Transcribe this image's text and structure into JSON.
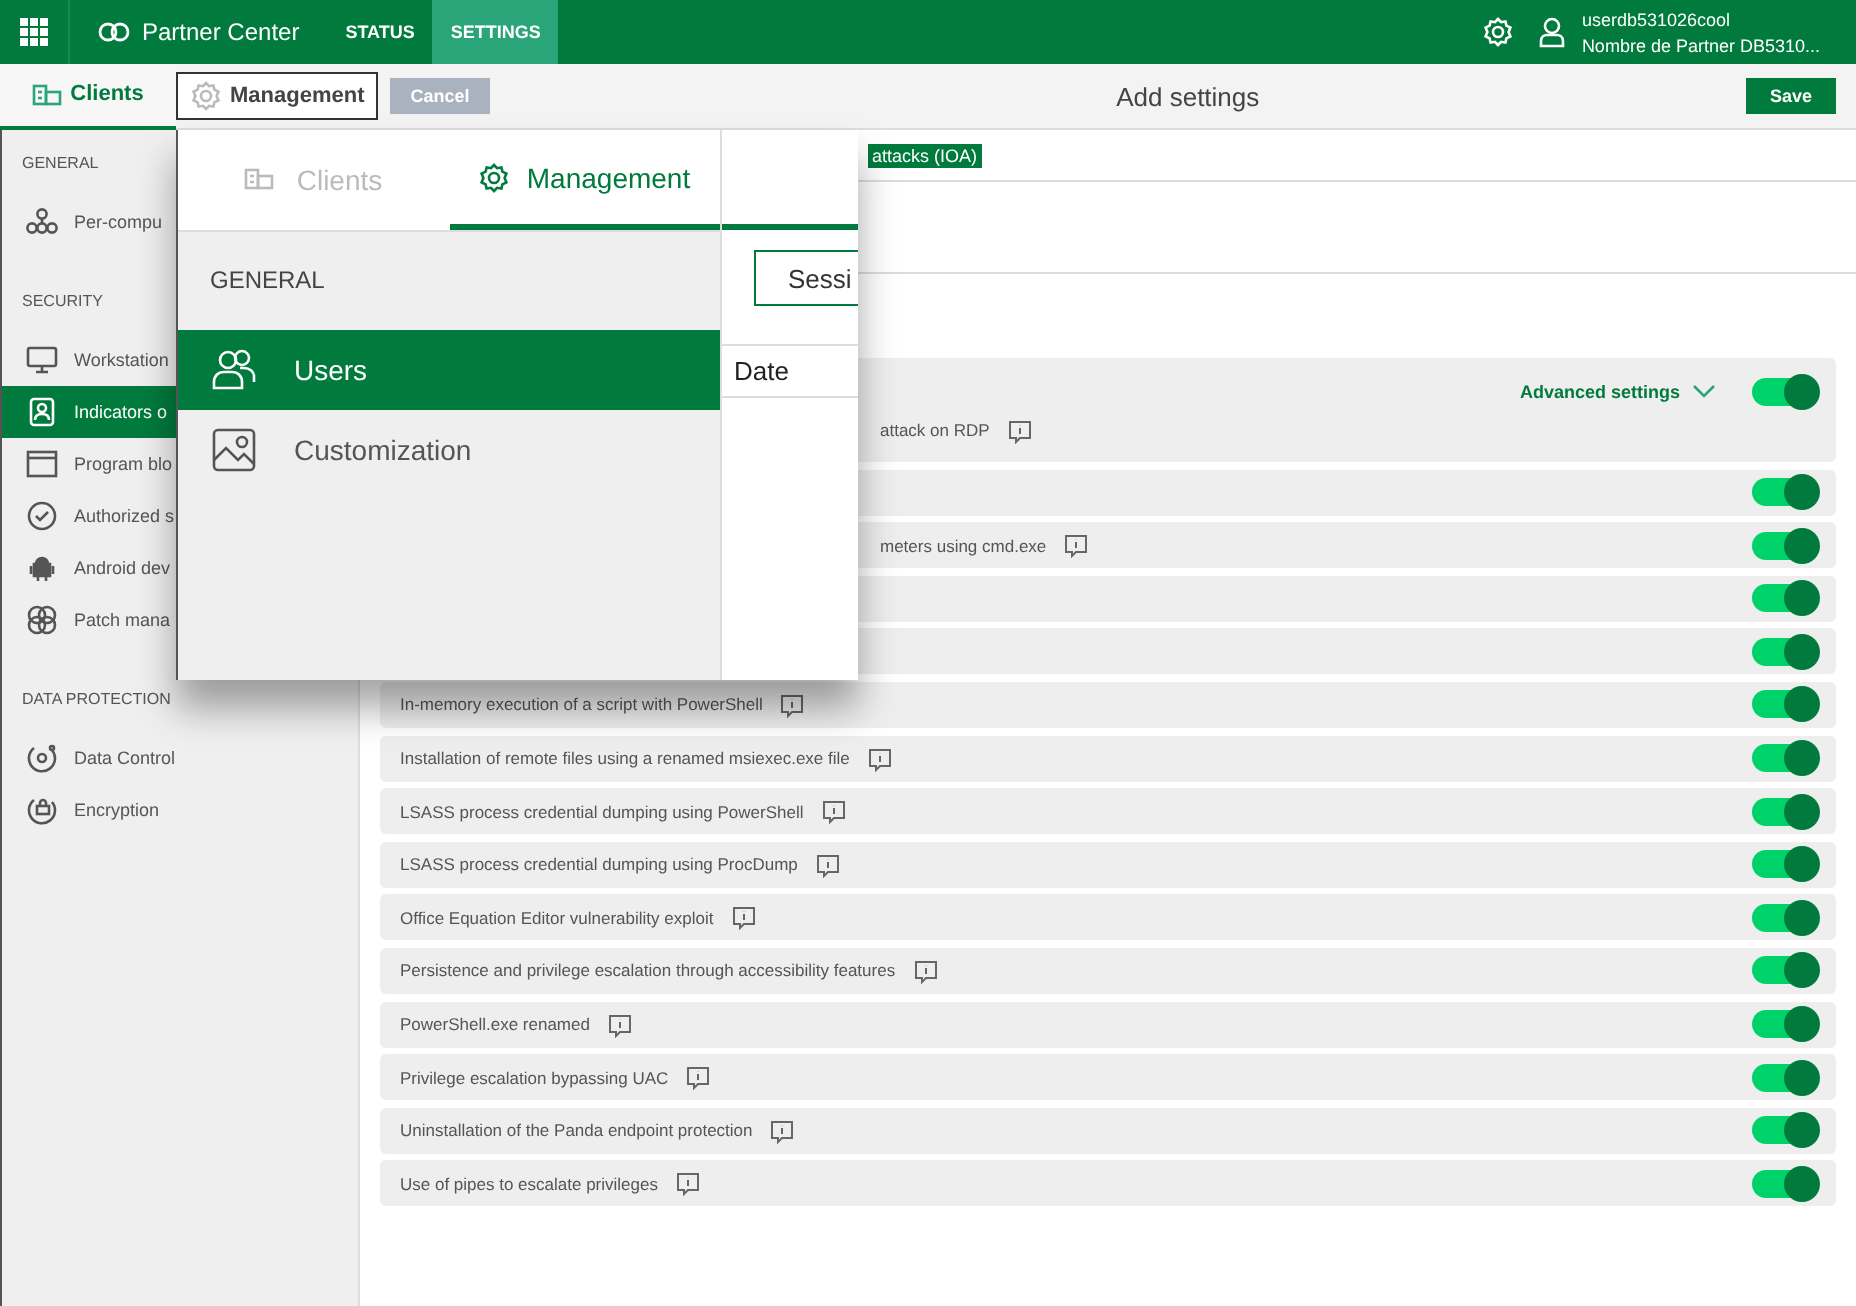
{
  "topbar": {
    "app_name": "Partner Center",
    "tabs": [
      {
        "label": "STATUS",
        "selected": false
      },
      {
        "label": "SETTINGS",
        "selected": true
      }
    ],
    "user": {
      "name": "userdb531026cool",
      "partner": "Nombre de Partner DB5310..."
    }
  },
  "subbar": {
    "clients_tab": {
      "label": "Clients",
      "selected": true
    },
    "management_button": "Management",
    "cancel_button": "Cancel",
    "title": "Add settings",
    "save_button": "Save"
  },
  "sidebar": {
    "sections": [
      {
        "heading": "GENERAL",
        "items": [
          {
            "label": "Per-compu",
            "selected": false
          }
        ]
      },
      {
        "heading": "SECURITY",
        "items": [
          {
            "label": "Workstation",
            "selected": false
          },
          {
            "label": "Indicators o",
            "selected": true
          },
          {
            "label": "Program blo",
            "selected": false
          },
          {
            "label": "Authorized s",
            "selected": false
          },
          {
            "label": "Android dev",
            "selected": false
          },
          {
            "label": "Patch mana",
            "selected": false
          }
        ]
      },
      {
        "heading": "DATA PROTECTION",
        "items": [
          {
            "label": "Data Control",
            "selected": false
          },
          {
            "label": "Encryption",
            "selected": false
          }
        ]
      }
    ]
  },
  "main": {
    "tab_label": "attacks (IOA)",
    "advanced_link": "Advanced settings",
    "rows": [
      {
        "kind": "clipped",
        "text": "attack on RDP",
        "on": true
      },
      {
        "kind": "blank",
        "on": true
      },
      {
        "kind": "clipped",
        "text": "meters using cmd.exe",
        "on": true
      },
      {
        "kind": "blank",
        "on": true
      },
      {
        "kind": "blank",
        "on": true
      },
      {
        "kind": "full",
        "text": "In-memory execution of a script with PowerShell",
        "on": true
      },
      {
        "kind": "full",
        "text": "Installation of remote files using a renamed msiexec.exe file",
        "on": true
      },
      {
        "kind": "full",
        "text": "LSASS process credential dumping using PowerShell",
        "on": true
      },
      {
        "kind": "full",
        "text": "LSASS process credential dumping using ProcDump",
        "on": true
      },
      {
        "kind": "full",
        "text": "Office Equation Editor vulnerability exploit",
        "on": true
      },
      {
        "kind": "full",
        "text": "Persistence and privilege escalation through accessibility features",
        "on": true
      },
      {
        "kind": "full",
        "text": "PowerShell.exe renamed",
        "on": true
      },
      {
        "kind": "full",
        "text": "Privilege escalation bypassing UAC",
        "on": true
      },
      {
        "kind": "full",
        "text": "Uninstallation of the Panda endpoint protection",
        "on": true
      },
      {
        "kind": "full",
        "text": "Use of pipes to escalate privileges",
        "on": true
      }
    ]
  },
  "overlay": {
    "tabs": [
      {
        "label": "Clients",
        "selected": false
      },
      {
        "label": "Management",
        "selected": true
      }
    ],
    "heading": "GENERAL",
    "items": [
      {
        "label": "Users",
        "selected": true
      },
      {
        "label": "Customization",
        "selected": false
      }
    ],
    "side_button": "Sessi",
    "column_header": "Date"
  }
}
